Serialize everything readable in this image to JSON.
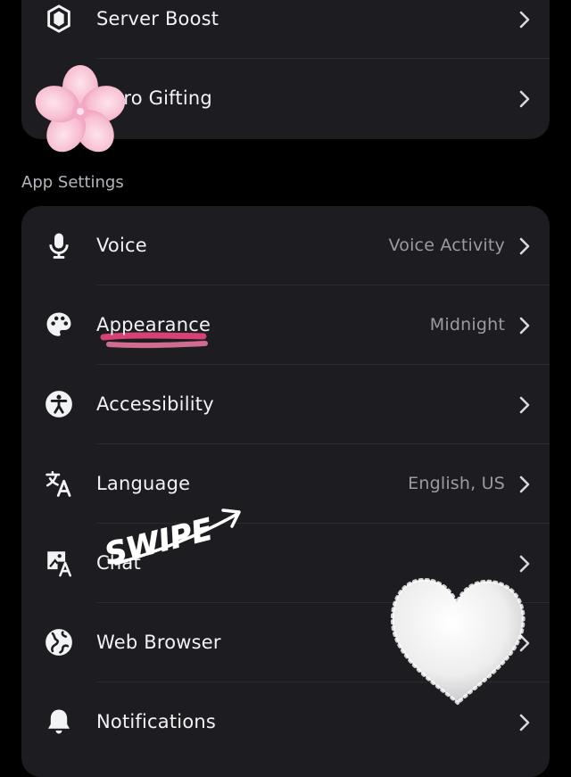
{
  "account_section": {
    "items": [
      {
        "label": "Server Boost",
        "value": "",
        "icon": "server-boost-icon"
      },
      {
        "label": "Nitro Gifting",
        "value": "",
        "icon": "gift-icon"
      }
    ]
  },
  "app_settings": {
    "section_label": "App Settings",
    "items": [
      {
        "label": "Voice",
        "value": "Voice Activity",
        "icon": "microphone-icon"
      },
      {
        "label": "Appearance",
        "value": "Midnight",
        "icon": "palette-icon"
      },
      {
        "label": "Accessibility",
        "value": "",
        "icon": "accessibility-icon"
      },
      {
        "label": "Language",
        "value": "English, US",
        "icon": "language-icon"
      },
      {
        "label": "Chat",
        "value": "",
        "icon": "chat-image-icon"
      },
      {
        "label": "Web Browser",
        "value": "",
        "icon": "globe-icon"
      },
      {
        "label": "Notifications",
        "value": "",
        "icon": "bell-icon"
      }
    ]
  },
  "overlay": {
    "swipe_text": "SWIPE",
    "stickers": [
      "pink-flower-sticker",
      "cloud-heart-sticker"
    ],
    "highlight_color": "#e0457b"
  },
  "colors": {
    "background": "#000000",
    "card": "#1c1c21",
    "label": "#f2f3f5",
    "value": "#9a9ba3"
  }
}
